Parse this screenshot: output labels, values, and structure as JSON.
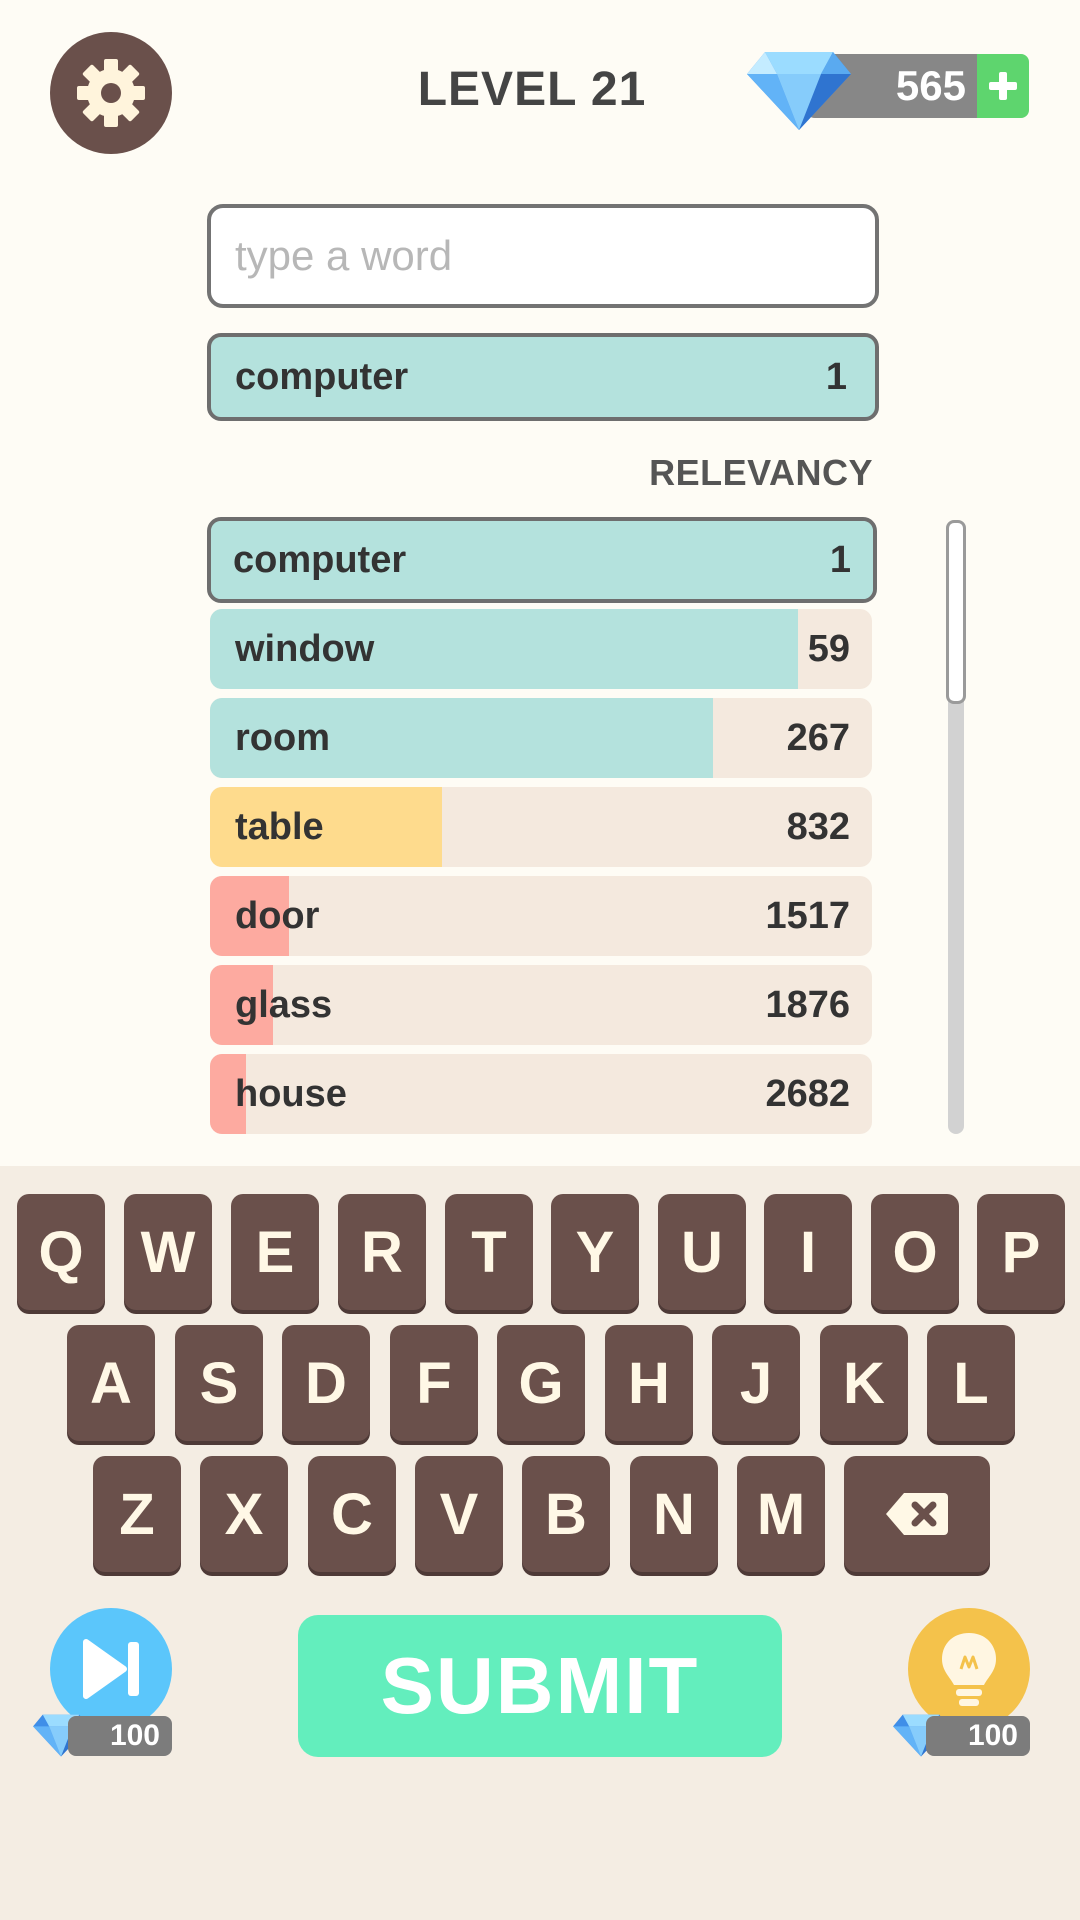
{
  "header": {
    "level_title": "LEVEL 21",
    "gem_count": "565",
    "plus_label": "+"
  },
  "input": {
    "placeholder": "type a word",
    "value": ""
  },
  "last_guess": {
    "word": "computer",
    "rank": "1"
  },
  "list_header": "RELEVANCY",
  "guesses": [
    {
      "word": "computer",
      "rank": "1",
      "fill": 1.0,
      "color": "#b4e2dd"
    },
    {
      "word": "window",
      "rank": "59",
      "fill": 0.888,
      "color": "#b4e2dd"
    },
    {
      "word": "room",
      "rank": "267",
      "fill": 0.76,
      "color": "#b4e2dd"
    },
    {
      "word": "table",
      "rank": "832",
      "fill": 0.35,
      "color": "#fedb8d"
    },
    {
      "word": "door",
      "rank": "1517",
      "fill": 0.12,
      "color": "#fdaaa0"
    },
    {
      "word": "glass",
      "rank": "1876",
      "fill": 0.095,
      "color": "#fdaaa0"
    },
    {
      "word": "house",
      "rank": "2682",
      "fill": 0.055,
      "color": "#fdaaa0"
    }
  ],
  "keyboard": {
    "row1": [
      "Q",
      "W",
      "E",
      "R",
      "T",
      "Y",
      "U",
      "I",
      "O",
      "P"
    ],
    "row2": [
      "A",
      "S",
      "D",
      "F",
      "G",
      "H",
      "J",
      "K",
      "L"
    ],
    "row3": [
      "Z",
      "X",
      "C",
      "V",
      "B",
      "N",
      "M"
    ]
  },
  "actions": {
    "submit_label": "SUBMIT",
    "skip_cost": "100",
    "hint_cost": "100"
  },
  "icons": {
    "settings": "gear-icon",
    "gem": "diamond-icon",
    "skip": "skip-forward-icon",
    "hint": "lightbulb-icon",
    "backspace": "backspace-icon"
  },
  "colors": {
    "accent_green": "#63eebd",
    "plus_green": "#5ed56e",
    "key_brown": "#6a504b",
    "close_teal": "#b4e2dd",
    "medium_yellow": "#fedb8d",
    "far_red": "#fdaaa0",
    "skip_blue": "#5bc6fb",
    "hint_yellow": "#f4c24b"
  }
}
